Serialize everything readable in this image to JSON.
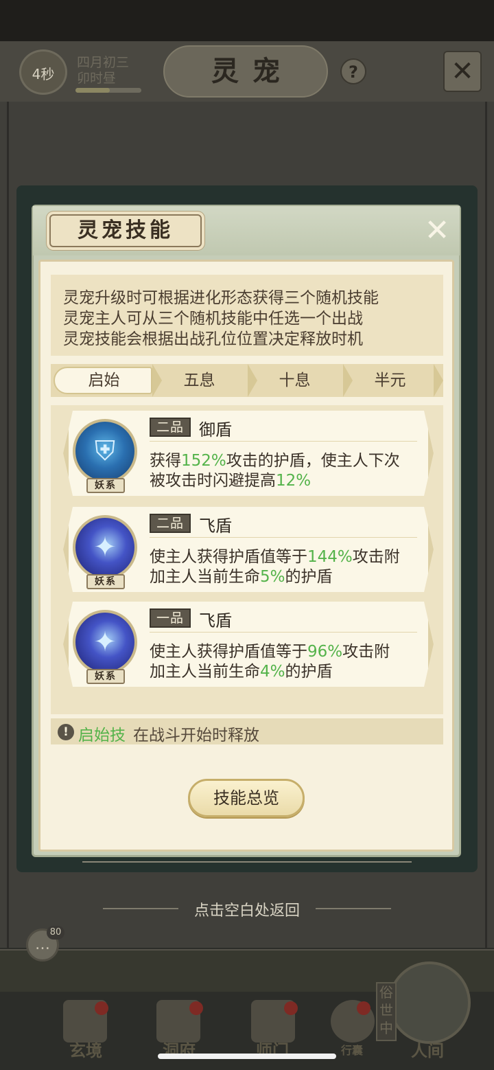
{
  "header": {
    "timer": "4秒",
    "date_line1": "四月初三",
    "date_line2": "卯时昼",
    "title": "灵宠",
    "help": "?"
  },
  "dialog": {
    "title": "灵宠技能",
    "description": [
      "灵宠升级时可根据进化形态获得三个随机技能",
      "灵宠主人可从三个随机技能中任选一个出战",
      "灵宠技能会根据出战孔位位置决定释放时机"
    ],
    "tabs": [
      {
        "label": "启始",
        "active": true
      },
      {
        "label": "五息",
        "active": false
      },
      {
        "label": "十息",
        "active": false
      },
      {
        "label": "半元",
        "active": false
      }
    ],
    "skills": [
      {
        "type_tag": "妖系",
        "grade": "二品",
        "name": "御盾",
        "desc1_a": "获得",
        "desc1_hl": "152%",
        "desc1_b": "攻击的护盾，使主人下次",
        "desc2_a": "被攻击时闪避提高",
        "desc2_hl": "12%",
        "desc2_b": ""
      },
      {
        "type_tag": "妖系",
        "grade": "二品",
        "name": "飞盾",
        "desc1_a": "使主人获得护盾值等于",
        "desc1_hl": "144%",
        "desc1_b": "攻击附",
        "desc2_a": "加主人当前生命",
        "desc2_hl": "5%",
        "desc2_b": "的护盾"
      },
      {
        "type_tag": "妖系",
        "grade": "一品",
        "name": "飞盾",
        "desc1_a": "使主人获得护盾值等于",
        "desc1_hl": "96%",
        "desc1_b": "攻击附",
        "desc2_a": "加主人当前生命",
        "desc2_hl": "4%",
        "desc2_b": "的护盾"
      }
    ],
    "hint_key": "启始技",
    "hint_rest": "在战斗开始时释放",
    "overview_button": "技能总览"
  },
  "return_hint": "点击空白处返回",
  "chat_count": "80",
  "bottom_nav": [
    {
      "label": "玄境"
    },
    {
      "label": "洞府"
    },
    {
      "label": "师门"
    },
    {
      "label": "行囊"
    },
    {
      "label": "人间"
    }
  ],
  "renjian_side": "俗世中",
  "colors": {
    "highlight_green": "#54b34a",
    "card_bg": "#fbf7e7",
    "panel_bg": "#f7f1de",
    "overlay_dark": "#3c3b37"
  }
}
